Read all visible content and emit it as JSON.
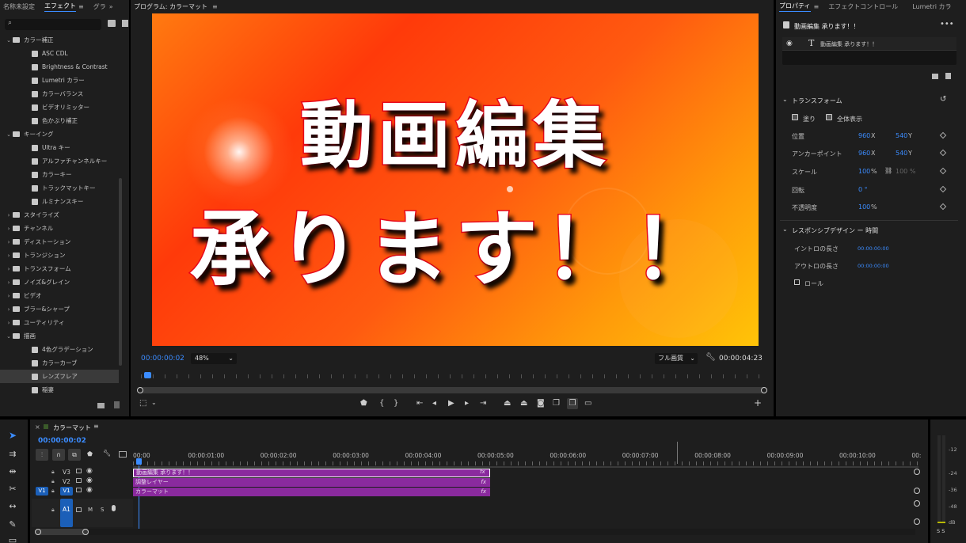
{
  "effects_panel": {
    "tabs": [
      "名称未設定",
      "エフェクト",
      "グラ"
    ],
    "tree": [
      {
        "label": "カラー補正",
        "type": "folder",
        "open": true,
        "indent": 1
      },
      {
        "label": "ASC CDL",
        "type": "effect",
        "indent": 2
      },
      {
        "label": "Brightness & Contrast",
        "type": "effect",
        "indent": 2
      },
      {
        "label": "Lumetri カラー",
        "type": "effect",
        "indent": 2
      },
      {
        "label": "カラーバランス",
        "type": "effect",
        "indent": 2
      },
      {
        "label": "ビデオリミッター",
        "type": "effect",
        "indent": 2
      },
      {
        "label": "色かぶり補正",
        "type": "effect",
        "indent": 2
      },
      {
        "label": "キーイング",
        "type": "folder",
        "open": true,
        "indent": 1
      },
      {
        "label": "Ultra キー",
        "type": "effect",
        "indent": 2
      },
      {
        "label": "アルファチャンネルキー",
        "type": "effect",
        "indent": 2
      },
      {
        "label": "カラーキー",
        "type": "effect",
        "indent": 2
      },
      {
        "label": "トラックマットキー",
        "type": "effect",
        "indent": 2
      },
      {
        "label": "ルミナンスキー",
        "type": "effect",
        "indent": 2
      },
      {
        "label": "スタイライズ",
        "type": "folder",
        "open": false,
        "indent": 1
      },
      {
        "label": "チャンネル",
        "type": "folder",
        "open": false,
        "indent": 1
      },
      {
        "label": "ディストーション",
        "type": "folder",
        "open": false,
        "indent": 1
      },
      {
        "label": "トランジション",
        "type": "folder",
        "open": false,
        "indent": 1
      },
      {
        "label": "トランスフォーム",
        "type": "folder",
        "open": false,
        "indent": 1
      },
      {
        "label": "ノイズ&グレイン",
        "type": "folder",
        "open": false,
        "indent": 1
      },
      {
        "label": "ビデオ",
        "type": "folder",
        "open": false,
        "indent": 1
      },
      {
        "label": "ブラー&シャープ",
        "type": "folder",
        "open": false,
        "indent": 1
      },
      {
        "label": "ユーティリティ",
        "type": "folder",
        "open": false,
        "indent": 1
      },
      {
        "label": "描画",
        "type": "folder",
        "open": true,
        "indent": 1
      },
      {
        "label": "4色グラデーション",
        "type": "effect",
        "indent": 2
      },
      {
        "label": "カラーカーブ",
        "type": "effect",
        "indent": 2
      },
      {
        "label": "レンズフレア",
        "type": "effect",
        "indent": 2,
        "selected": true
      },
      {
        "label": "稲妻",
        "type": "effect",
        "indent": 2
      }
    ]
  },
  "program_monitor": {
    "tab": "プログラム: カラーマット",
    "title_line1": "動画編集",
    "title_line2": "承ります！！",
    "timecode": "00:00:00:02",
    "zoom": "48%",
    "quality": "フル画質",
    "duration": "00:00:04:23"
  },
  "properties_panel": {
    "tabs": [
      "プロパティ",
      "エフェクトコントロール",
      "Lumetri カラ"
    ],
    "clip_title": "動画編集 承ります！！",
    "layer_name": "動画編集 承ります！！",
    "transform_header": "トランスフォーム",
    "fill_label": "塗り",
    "show_all_label": "全体表示",
    "position": {
      "label": "位置",
      "x": "960",
      "y": "540"
    },
    "anchor": {
      "label": "アンカーポイント",
      "x": "960",
      "y": "540"
    },
    "scale": {
      "label": "スケール",
      "value": "100",
      "unit": "%",
      "linked_value": "100 %"
    },
    "rotation": {
      "label": "回転",
      "value": "0 °"
    },
    "opacity": {
      "label": "不透明度",
      "value": "100",
      "unit": "%"
    },
    "responsive_header": "レスポンシブデザイン ー 時間",
    "intro": {
      "label": "イントロの長さ",
      "value": "00:00:00:00"
    },
    "outro": {
      "label": "アウトロの長さ",
      "value": "00:00:00:00"
    },
    "roll_label": "ロール",
    "axis_x": "X",
    "axis_y": "Y"
  },
  "timeline": {
    "sequence_name": "カラーマット",
    "timecode": "00:00:00:02",
    "ruler": [
      "00:00",
      "00:00:01:00",
      "00:00:02:00",
      "00:00:03:00",
      "00:00:04:00",
      "00:00:05:00",
      "00:00:06:00",
      "00:00:07:00",
      "00:00:08:00",
      "00:00:09:00",
      "00:00:10:00",
      "00:"
    ],
    "tracks": [
      {
        "name": "V3",
        "clip": "動画編集 承ります！！"
      },
      {
        "name": "V2",
        "clip": "調整レイヤー"
      },
      {
        "name": "V1",
        "clip": "カラーマット",
        "source": "V1"
      }
    ],
    "audio_track": "A1",
    "fx_badge": "fx"
  },
  "meter": {
    "ticks": [
      "-12",
      "-24",
      "-36",
      "-48",
      "dB"
    ]
  },
  "colors": {
    "accent": "#3b8cff",
    "clip": "#8a2a9e",
    "title_stroke": "#e8081a"
  }
}
